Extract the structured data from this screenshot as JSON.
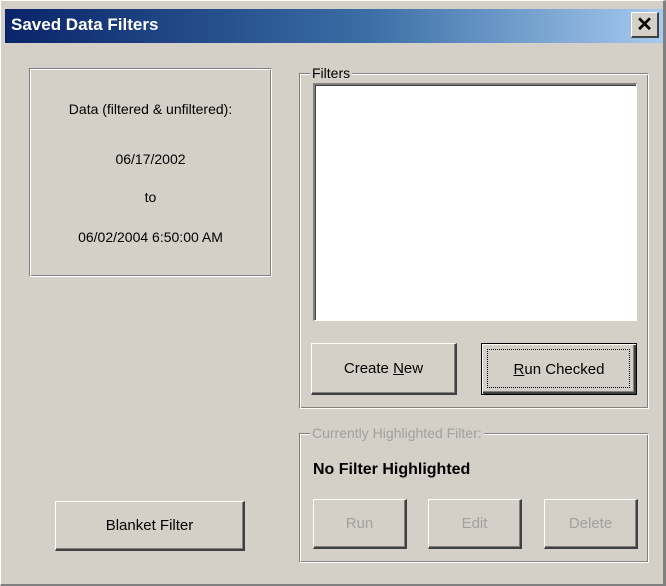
{
  "window": {
    "title": "Saved Data Filters",
    "close_symbol": "✕",
    "colors": {
      "face": "#d4d0c8",
      "titlebar_start": "#0a246a",
      "titlebar_end": "#a6caf0",
      "disabled_text": "#a0a0a0"
    }
  },
  "data_range": {
    "heading": "Data (filtered & unfiltered):",
    "start": "06/17/2002",
    "separator": "to",
    "end": "06/02/2004 6:50:00 AM"
  },
  "filters_group": {
    "legend": "Filters",
    "items": [],
    "create_new": {
      "pre": "Create ",
      "mnemonic": "N",
      "post": "ew"
    },
    "run_checked": {
      "pre": "",
      "mnemonic": "R",
      "post": "un Checked"
    }
  },
  "highlighted_group": {
    "legend": "Currently Highlighted Filter:",
    "status": "No Filter Highlighted",
    "run_label": "Run",
    "edit_label": "Edit",
    "delete_label": "Delete"
  },
  "blanket_filter_label": "Blanket Filter"
}
